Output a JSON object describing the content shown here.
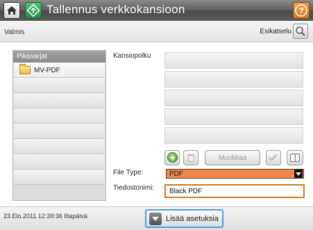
{
  "header": {
    "title": "Tallennus verkkokansioon",
    "home_icon": "home-icon",
    "app_icon": "save-to-folder-icon",
    "help_icon": "help-icon",
    "accent_help": "#e48a2a"
  },
  "status": {
    "text": "Valmis",
    "preview_label": "Esikatselu",
    "preview_icon": "magnifier-icon"
  },
  "quicksets": {
    "header": "Pikasarjat",
    "items": [
      {
        "label": "MV-PDF",
        "icon": "folder-icon"
      },
      {
        "label": ""
      },
      {
        "label": ""
      },
      {
        "label": ""
      },
      {
        "label": ""
      },
      {
        "label": ""
      },
      {
        "label": ""
      },
      {
        "label": ""
      }
    ]
  },
  "folder_path": {
    "label": "Kansiopolku",
    "rows": [
      "",
      "",
      "",
      "",
      ""
    ]
  },
  "toolbar": {
    "add_icon": "add-icon",
    "delete_icon": "trash-icon",
    "edit_label": "Muokkaa",
    "check_icon": "checkmark-icon",
    "book_icon": "address-book-icon"
  },
  "file_type": {
    "label": "File Type:",
    "value": "PDF",
    "color": "#f0874e"
  },
  "file_name": {
    "label": "Tiedostonimi:",
    "value": "Black PDF"
  },
  "footer": {
    "datetime": "23.Elo.2011 12:39:36 Iltapäivä",
    "more_options_label": "Lisää asetuksia"
  }
}
